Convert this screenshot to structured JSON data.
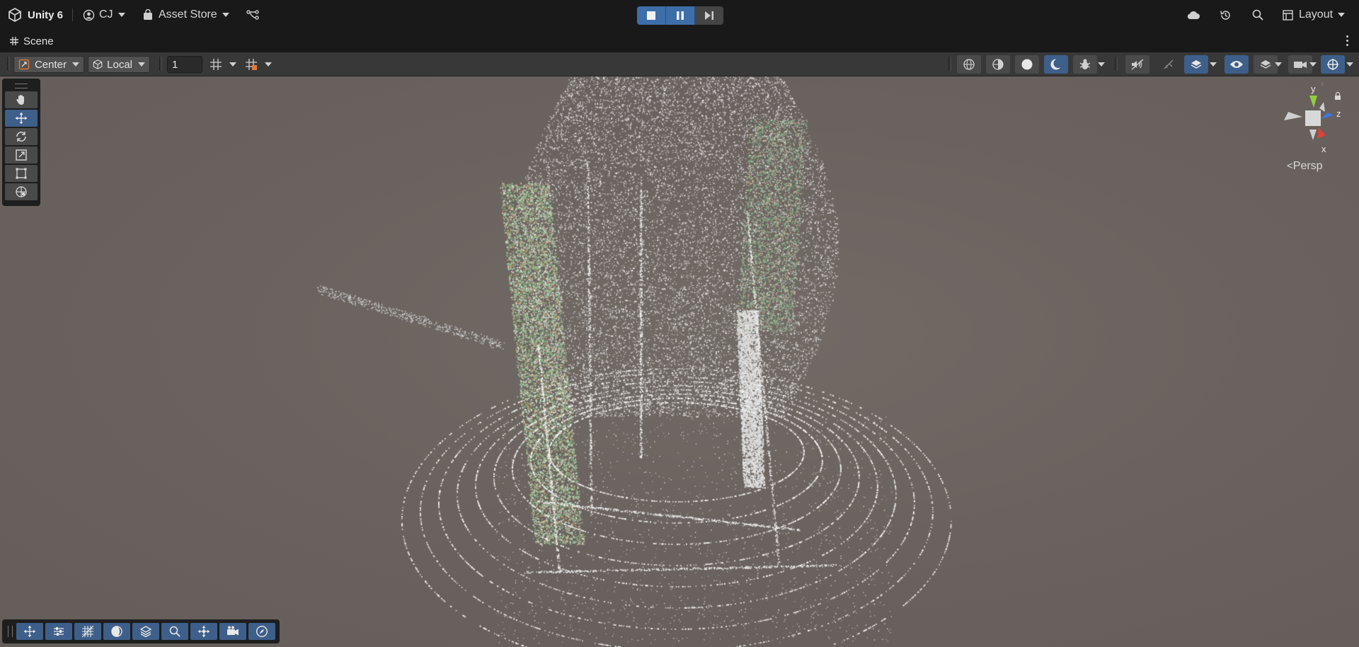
{
  "topbar": {
    "app_title": "Unity 6",
    "account_label": "CJ",
    "asset_store_label": "Asset Store",
    "layout_label": "Layout"
  },
  "tab": {
    "label": "Scene"
  },
  "toolbar": {
    "pivot_label": "Center",
    "space_label": "Local",
    "grid_snap_value": "1"
  },
  "viewport": {
    "projection_label": "Persp",
    "gizmo_axes": {
      "y": "y",
      "z": "z",
      "x": "x"
    }
  },
  "colors": {
    "accent": "#3e6ea8",
    "active_tool": "#3e5f8a",
    "scene_bg": "#6a625e",
    "gizmo_x": "#d9433d",
    "gizmo_y": "#8fcf3f",
    "gizmo_z": "#3f78e0"
  },
  "icons": {
    "tools": [
      "hand-icon",
      "move-icon",
      "rotate-icon",
      "scale-icon",
      "rect-icon",
      "transform-icon"
    ],
    "bottom_overlay": [
      "move-icon",
      "align-icon",
      "grid-icon",
      "shading-icon",
      "layers-icon",
      "zoom-icon",
      "move-icon",
      "camera-icon",
      "compass-icon"
    ]
  }
}
